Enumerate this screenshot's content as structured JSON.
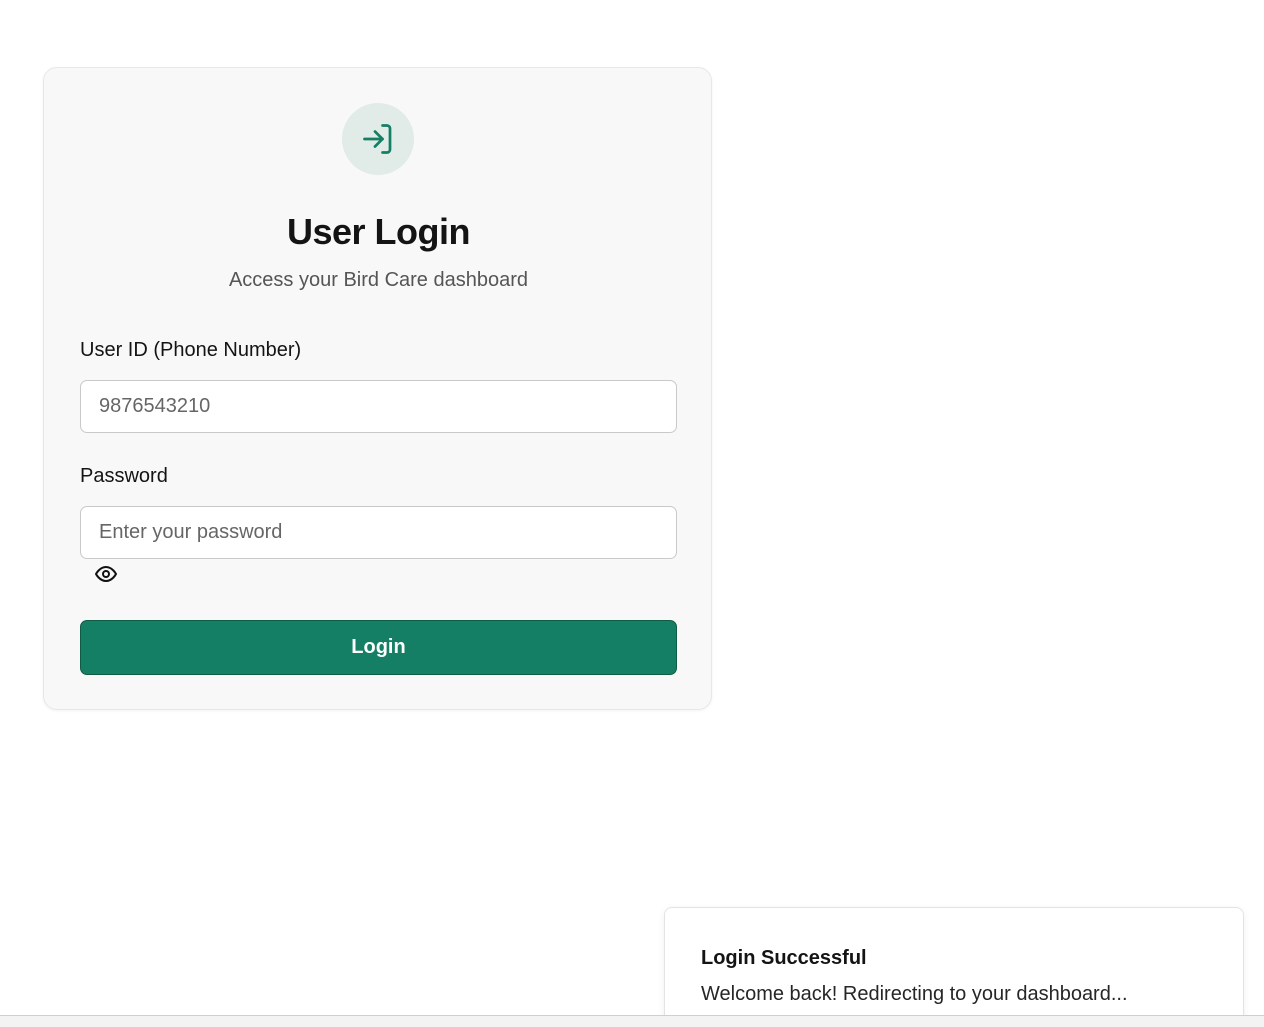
{
  "login_card": {
    "icon": "login-arrow-icon",
    "title": "User Login",
    "subtitle": "Access your Bird Care dashboard",
    "user_id": {
      "label": "User ID (Phone Number)",
      "placeholder": "9876543210",
      "value": ""
    },
    "password": {
      "label": "Password",
      "placeholder": "Enter your password",
      "value": "",
      "toggle_icon": "eye-icon"
    },
    "login_button_label": "Login"
  },
  "toast": {
    "title": "Login Successful",
    "message": "Welcome back! Redirecting to your dashboard..."
  },
  "colors": {
    "accent": "#147f64",
    "icon_circle": "#e1ebe7",
    "card_background": "#f8f8f8"
  }
}
